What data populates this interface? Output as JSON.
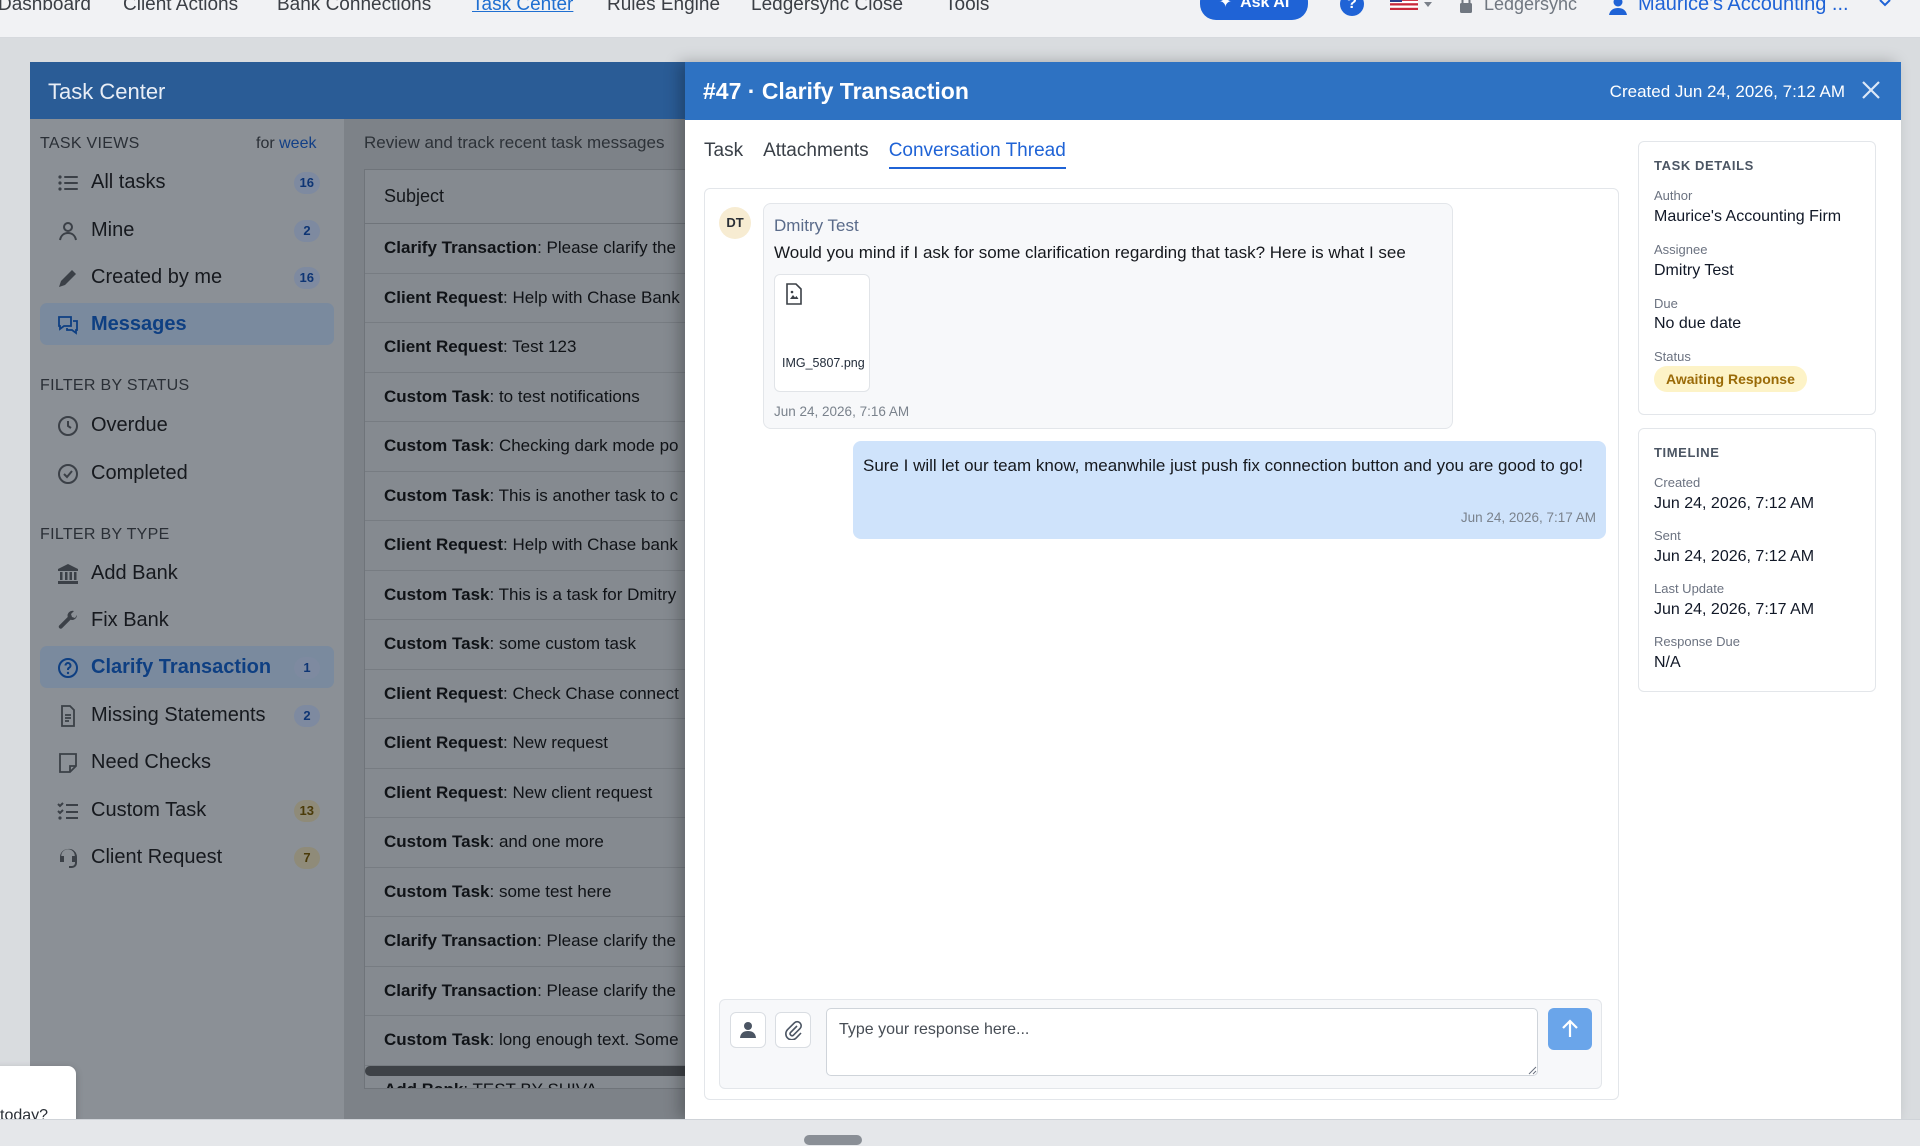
{
  "topnav": {
    "links": [
      "Dashboard",
      "Client Actions",
      "Bank Connections",
      "Task Center",
      "Rules Engine",
      "Ledgersync Close",
      "Tools"
    ],
    "active": "Task Center",
    "ask_ai_label": "Ask AI",
    "help_glyph": "?",
    "ledgersync_label": "Ledgersync",
    "firm_label": "Maurice's Accounting ..."
  },
  "task_center": {
    "title": "Task Center",
    "views_section": "TASK VIEWS",
    "for_label": "for",
    "for_period": "week",
    "views": [
      {
        "label": "All tasks",
        "count": "16",
        "icon": "list-icon"
      },
      {
        "label": "Mine",
        "count": "2",
        "icon": "person-icon"
      },
      {
        "label": "Created by me",
        "count": "16",
        "icon": "pencil-icon"
      },
      {
        "label": "Messages",
        "count": "",
        "icon": "chat-bubbles-icon",
        "active": true
      }
    ],
    "status_section": "FILTER BY STATUS",
    "statuses": [
      {
        "label": "Overdue",
        "icon": "clock-icon"
      },
      {
        "label": "Completed",
        "icon": "check-circle-icon"
      }
    ],
    "type_section": "FILTER BY TYPE",
    "types": [
      {
        "label": "Add Bank",
        "count": "",
        "icon": "bank-icon"
      },
      {
        "label": "Fix Bank",
        "count": "",
        "icon": "wrench-icon"
      },
      {
        "label": "Clarify Transaction",
        "count": "1",
        "icon": "question-circle-icon",
        "active": true
      },
      {
        "label": "Missing Statements",
        "count": "2",
        "icon": "document-icon"
      },
      {
        "label": "Need Checks",
        "count": "",
        "icon": "note-icon"
      },
      {
        "label": "Custom Task",
        "count": "13",
        "icon": "checklist-icon"
      },
      {
        "label": "Client Request",
        "count": "7",
        "icon": "headset-icon"
      }
    ]
  },
  "task_list": {
    "caption": "Review and track recent task messages",
    "column": "Subject",
    "rows": [
      {
        "type": "Clarify Transaction",
        "text": "Please clarify the"
      },
      {
        "type": "Client Request",
        "text": "Help with Chase Bank"
      },
      {
        "type": "Client Request",
        "text": "Test 123"
      },
      {
        "type": "Custom Task",
        "text": "to test notifications"
      },
      {
        "type": "Custom Task",
        "text": "Checking dark mode po"
      },
      {
        "type": "Custom Task",
        "text": "This is another task to c"
      },
      {
        "type": "Client Request",
        "text": "Help with Chase bank"
      },
      {
        "type": "Custom Task",
        "text": "This is a task for Dmitry"
      },
      {
        "type": "Custom Task",
        "text": "some custom task"
      },
      {
        "type": "Client Request",
        "text": "Check Chase connect"
      },
      {
        "type": "Client Request",
        "text": "New request"
      },
      {
        "type": "Client Request",
        "text": "New client request"
      },
      {
        "type": "Custom Task",
        "text": "and one more"
      },
      {
        "type": "Custom Task",
        "text": "some test here"
      },
      {
        "type": "Clarify Transaction",
        "text": "Please clarify the"
      },
      {
        "type": "Clarify Transaction",
        "text": "Please clarify the"
      },
      {
        "type": "Custom Task",
        "text": "long enough text. Some"
      },
      {
        "type": "Add Bank",
        "text": "TEST BY SHIVA"
      }
    ]
  },
  "detail": {
    "title": "#47 · Clarify Transaction",
    "created": "Created Jun 24, 2026, 7:12 AM",
    "tabs": [
      "Task",
      "Attachments",
      "Conversation Thread"
    ],
    "active_tab": "Conversation Thread",
    "messages": {
      "incoming": {
        "initials": "DT",
        "author": "Dmitry Test",
        "text": "Would you mind if I ask for some clarification regarding that task? Here is what I see",
        "attachment_name": "IMG_5807.png",
        "time": "Jun 24, 2026, 7:16 AM"
      },
      "outgoing": {
        "text": "Sure I will let our team know, meanwhile just push fix connection button and you are good to go!",
        "time": "Jun 24, 2026, 7:17 AM"
      }
    },
    "composer": {
      "placeholder": "Type your response here...",
      "value": ""
    },
    "task_details": {
      "title": "TASK DETAILS",
      "author_label": "Author",
      "author": "Maurice's Accounting Firm",
      "assignee_label": "Assignee",
      "assignee": "Dmitry Test",
      "due_label": "Due",
      "due": "No due date",
      "status_label": "Status",
      "status": "Awaiting Response"
    },
    "timeline": {
      "title": "TIMELINE",
      "created_label": "Created",
      "created": "Jun 24, 2026, 7:12 AM",
      "sent_label": "Sent",
      "sent": "Jun 24, 2026, 7:12 AM",
      "last_update_label": "Last Update",
      "last_update": "Jun 24, 2026, 7:17 AM",
      "response_due_label": "Response Due",
      "response_due": "N/A"
    }
  },
  "toast": {
    "text": "today?"
  },
  "colors": {
    "brand_blue": "#2e72c2",
    "link_blue": "#1f63d6",
    "outgoing_bubble": "#cfe3fb",
    "status_badge_bg": "#fdf3c7",
    "status_badge_text": "#9a6a07"
  }
}
